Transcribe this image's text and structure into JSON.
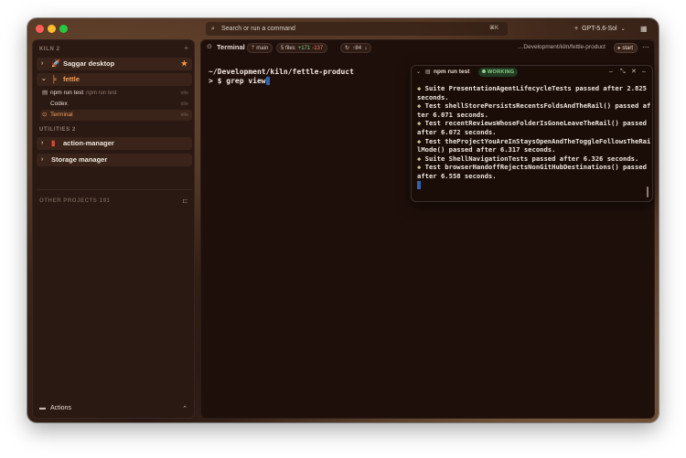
{
  "titlebar": {
    "command_placeholder": "Search or run a command",
    "command_shortcut": "⌘K",
    "model_label": "GPT-5.6-Sol"
  },
  "sidebar": {
    "kiln_header": "KILN 2",
    "projects": [
      {
        "label": "Saggar desktop",
        "starred": true
      },
      {
        "label": "fettle"
      }
    ],
    "fettle_items": [
      {
        "label": "npm run test",
        "sub": "npm run test",
        "status": "idle"
      },
      {
        "label": "Codex",
        "status": "idle"
      },
      {
        "label": "Terminal",
        "status": "idle"
      }
    ],
    "utilities_header": "UTILITIES 2",
    "utilities": [
      {
        "label": "action-manager"
      },
      {
        "label": "Storage manager"
      }
    ],
    "other_projects": "OTHER PROJECTS 191",
    "actions_label": "Actions"
  },
  "main": {
    "title": "Terminal",
    "branch": "main",
    "files": "5 files",
    "added": "+171",
    "removed": "-137",
    "ahead": "84",
    "path": "…Development/kiln/fettle-product",
    "start_label": "start",
    "terminal_lines": {
      "cwd": "~/Development/kiln/fettle-product",
      "prompt": "> $ grep view"
    }
  },
  "npm_panel": {
    "title": "npm run test",
    "status": "WORKING",
    "output": [
      "Suite PresentationAgentLifecycleTests passed after 2.825 seconds.",
      "Test shellStorePersistsRecentsFoldsAndTheRail() passed after 6.071 seconds.",
      "Test recentReviewsWhoseFolderIsGoneLeaveTheRail() passed after 6.072 seconds.",
      "Test theProjectYouAreInStaysOpenAndTheToggleFollowsTheRailMode() passed after 6.317 seconds.",
      "Suite ShellNavigationTests passed after 6.326 seconds.",
      "Test browserHandoffRejectsNonGitHubDestinations() passed after 6.558 seconds."
    ]
  },
  "colors": {
    "accent": "#f3a060",
    "working": "#8fd08a",
    "selection": "#2d63b3"
  }
}
